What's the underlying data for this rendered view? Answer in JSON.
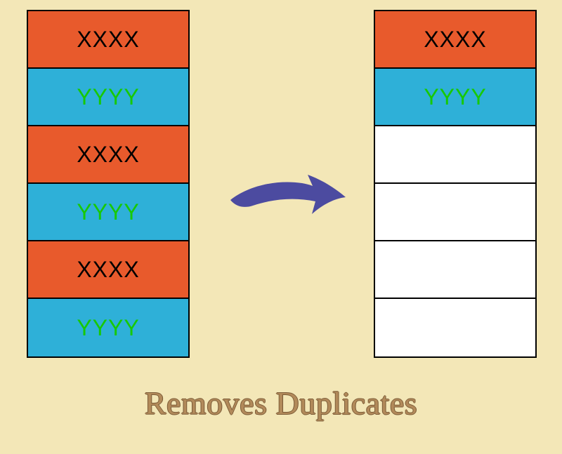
{
  "left_table": {
    "rows": [
      {
        "label": "XXXX",
        "kind": "orange"
      },
      {
        "label": "YYYY",
        "kind": "blue"
      },
      {
        "label": "XXXX",
        "kind": "orange"
      },
      {
        "label": "YYYY",
        "kind": "blue"
      },
      {
        "label": "XXXX",
        "kind": "orange"
      },
      {
        "label": "YYYY",
        "kind": "blue"
      }
    ]
  },
  "right_table": {
    "rows": [
      {
        "label": "XXXX",
        "kind": "orange"
      },
      {
        "label": "YYYY",
        "kind": "blue"
      },
      {
        "label": "",
        "kind": "white"
      },
      {
        "label": "",
        "kind": "white"
      },
      {
        "label": "",
        "kind": "white"
      },
      {
        "label": "",
        "kind": "white"
      }
    ]
  },
  "caption": "Removes Duplicates",
  "colors": {
    "background": "#f3e7b7",
    "orange": "#e85a2c",
    "blue": "#2eb0d8",
    "arrow": "#4c4ba0",
    "caption": "#b28a5a",
    "yy_text": "#17c900"
  }
}
